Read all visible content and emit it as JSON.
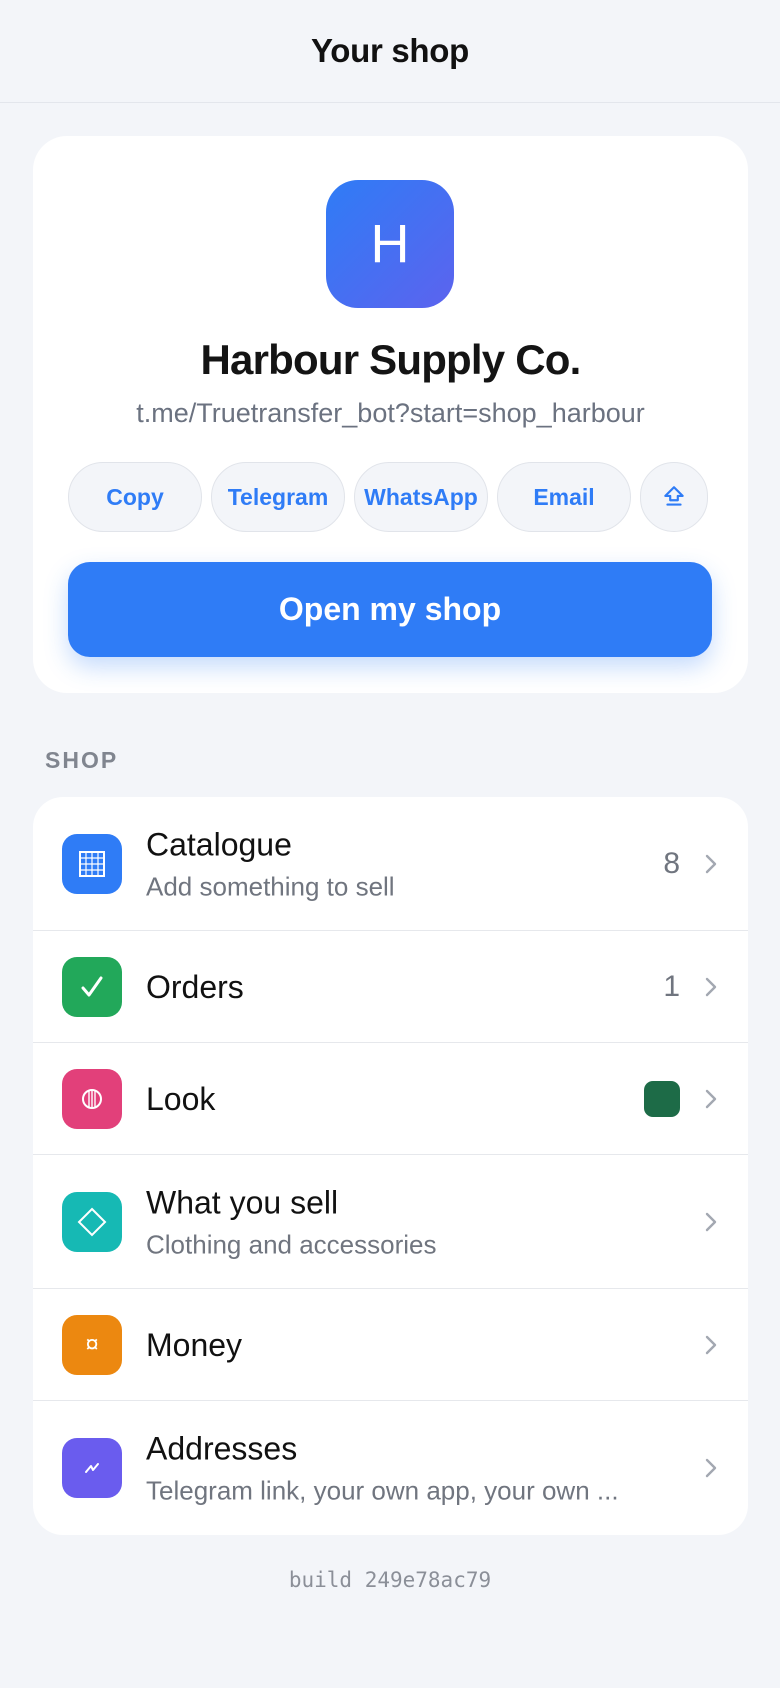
{
  "header": {
    "title": "Your shop"
  },
  "shop": {
    "logo_letter": "H",
    "name": "Harbour Supply Co.",
    "link": "t.me/Truetransfer_bot?start=shop_harbour",
    "share": {
      "copy": "Copy",
      "telegram": "Telegram",
      "whatsapp": "WhatsApp",
      "email": "Email",
      "more_icon": "share-icon"
    },
    "open_button": "Open my shop"
  },
  "section": {
    "label": "SHOP"
  },
  "items": [
    {
      "title": "Catalogue",
      "subtitle": "Add something to sell",
      "count": "8",
      "icon": "grid-icon",
      "color": "#2f7cf6"
    },
    {
      "title": "Orders",
      "count": "1",
      "icon": "check-icon",
      "color": "#22a85a"
    },
    {
      "title": "Look",
      "swatch": "#1d6b47",
      "icon": "palette-icon",
      "color": "#e2407a"
    },
    {
      "title": "What you sell",
      "subtitle": "Clothing and accessories",
      "icon": "diamond-icon",
      "color": "#16b9b4"
    },
    {
      "title": "Money",
      "icon": "currency-icon",
      "color": "#ec8810"
    },
    {
      "title": "Addresses",
      "subtitle": "Telegram link, your own app, your own ...",
      "icon": "link-icon",
      "color": "#6a5cee"
    }
  ],
  "footer": {
    "build": "build 249e78ac79"
  }
}
